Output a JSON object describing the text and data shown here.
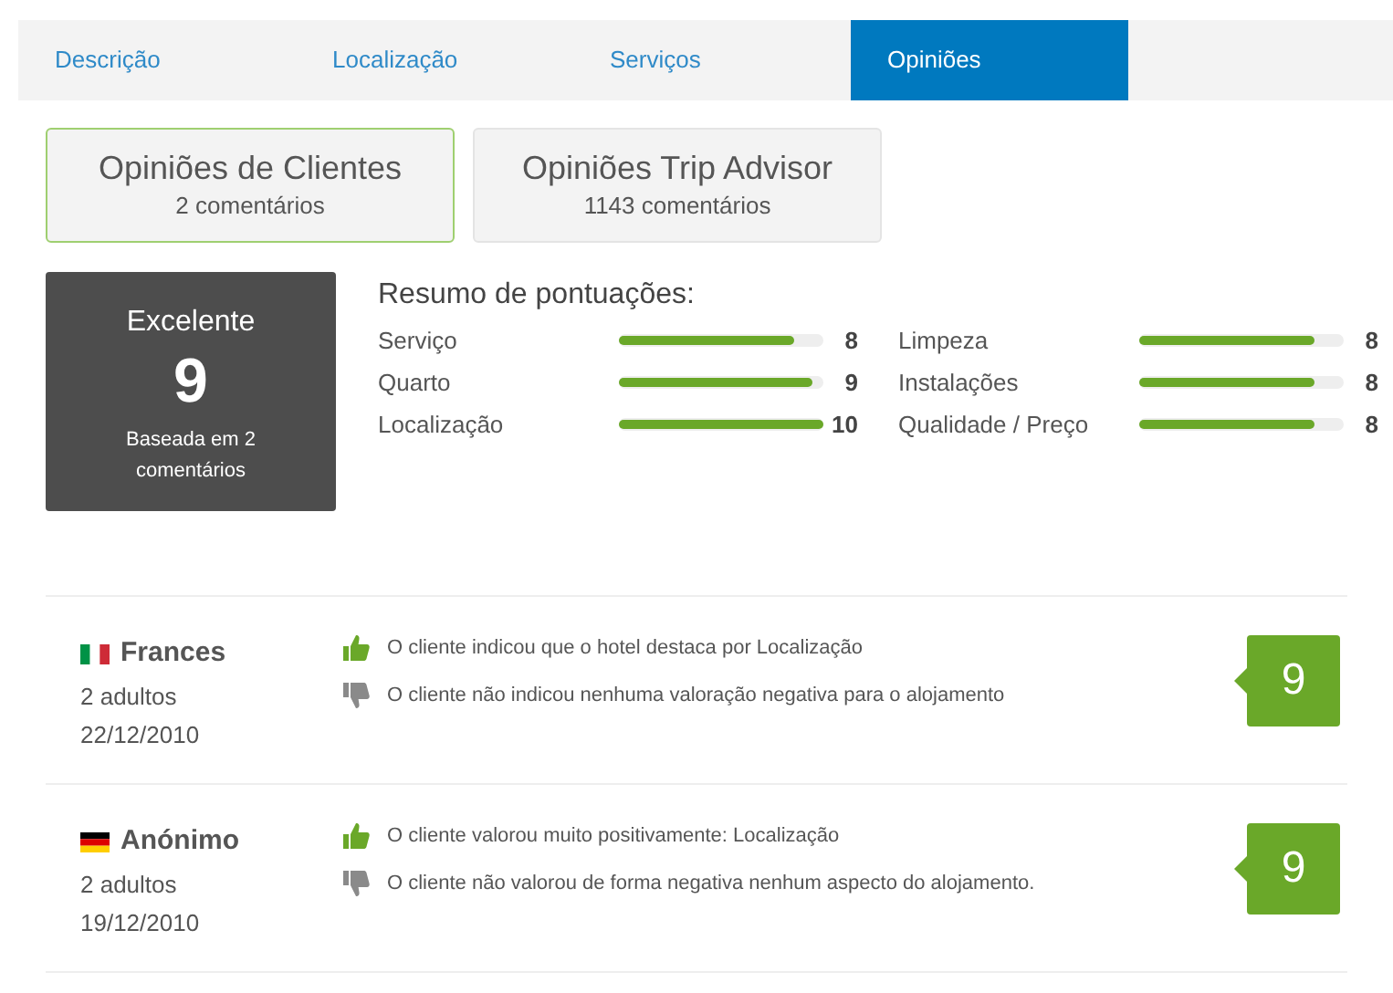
{
  "tabs": [
    {
      "label": "Descrição",
      "selected": false
    },
    {
      "label": "Localização",
      "selected": false
    },
    {
      "label": "Serviços",
      "selected": false
    },
    {
      "label": "Opiniões",
      "selected": true
    }
  ],
  "review_sources": [
    {
      "title": "Opiniões de Clientes",
      "count": "2 comentários",
      "selected": true
    },
    {
      "title": "Opiniões Trip Advisor",
      "count": "1143 comentários",
      "selected": false
    }
  ],
  "overall": {
    "rating": "Excelente",
    "score": "9",
    "basis": "Baseada em 2 comentários"
  },
  "summary": {
    "title": "Resumo de pontuações:",
    "columns": [
      [
        {
          "label": "Serviço",
          "level": 0.86,
          "score": "8"
        },
        {
          "label": "Quarto",
          "level": 0.95,
          "score": "9"
        },
        {
          "label": "Localização",
          "level": 1,
          "score": "10"
        }
      ],
      [
        {
          "label": "Limpeza",
          "level": 0.86,
          "score": "8"
        },
        {
          "label": "Instalações",
          "level": 0.86,
          "score": "8"
        },
        {
          "label": "Qualidade / Preço",
          "level": 0.86,
          "score": "8"
        }
      ]
    ]
  },
  "reviews": [
    {
      "flag": {
        "kind": "italy"
      },
      "name": "Frances",
      "guests": "2 adultos",
      "date": "22/12/2010",
      "score": "9",
      "comments": [
        {
          "kind": "positive",
          "text": "O cliente indicou que o hotel destaca por Localização"
        },
        {
          "kind": "negative",
          "text": "O cliente não indicou nenhuma valoração negativa para o alojamento"
        }
      ]
    },
    {
      "flag": {
        "kind": "germany"
      },
      "name": "Anónimo",
      "guests": "2 adultos",
      "date": "19/12/2010",
      "score": "9",
      "comments": [
        {
          "kind": "positive",
          "text": "O cliente valorou muito positivamente: Localização"
        },
        {
          "kind": "negative",
          "text": "O cliente não valorou de forma negativa nenhum aspecto do alojamento."
        }
      ]
    }
  ]
}
